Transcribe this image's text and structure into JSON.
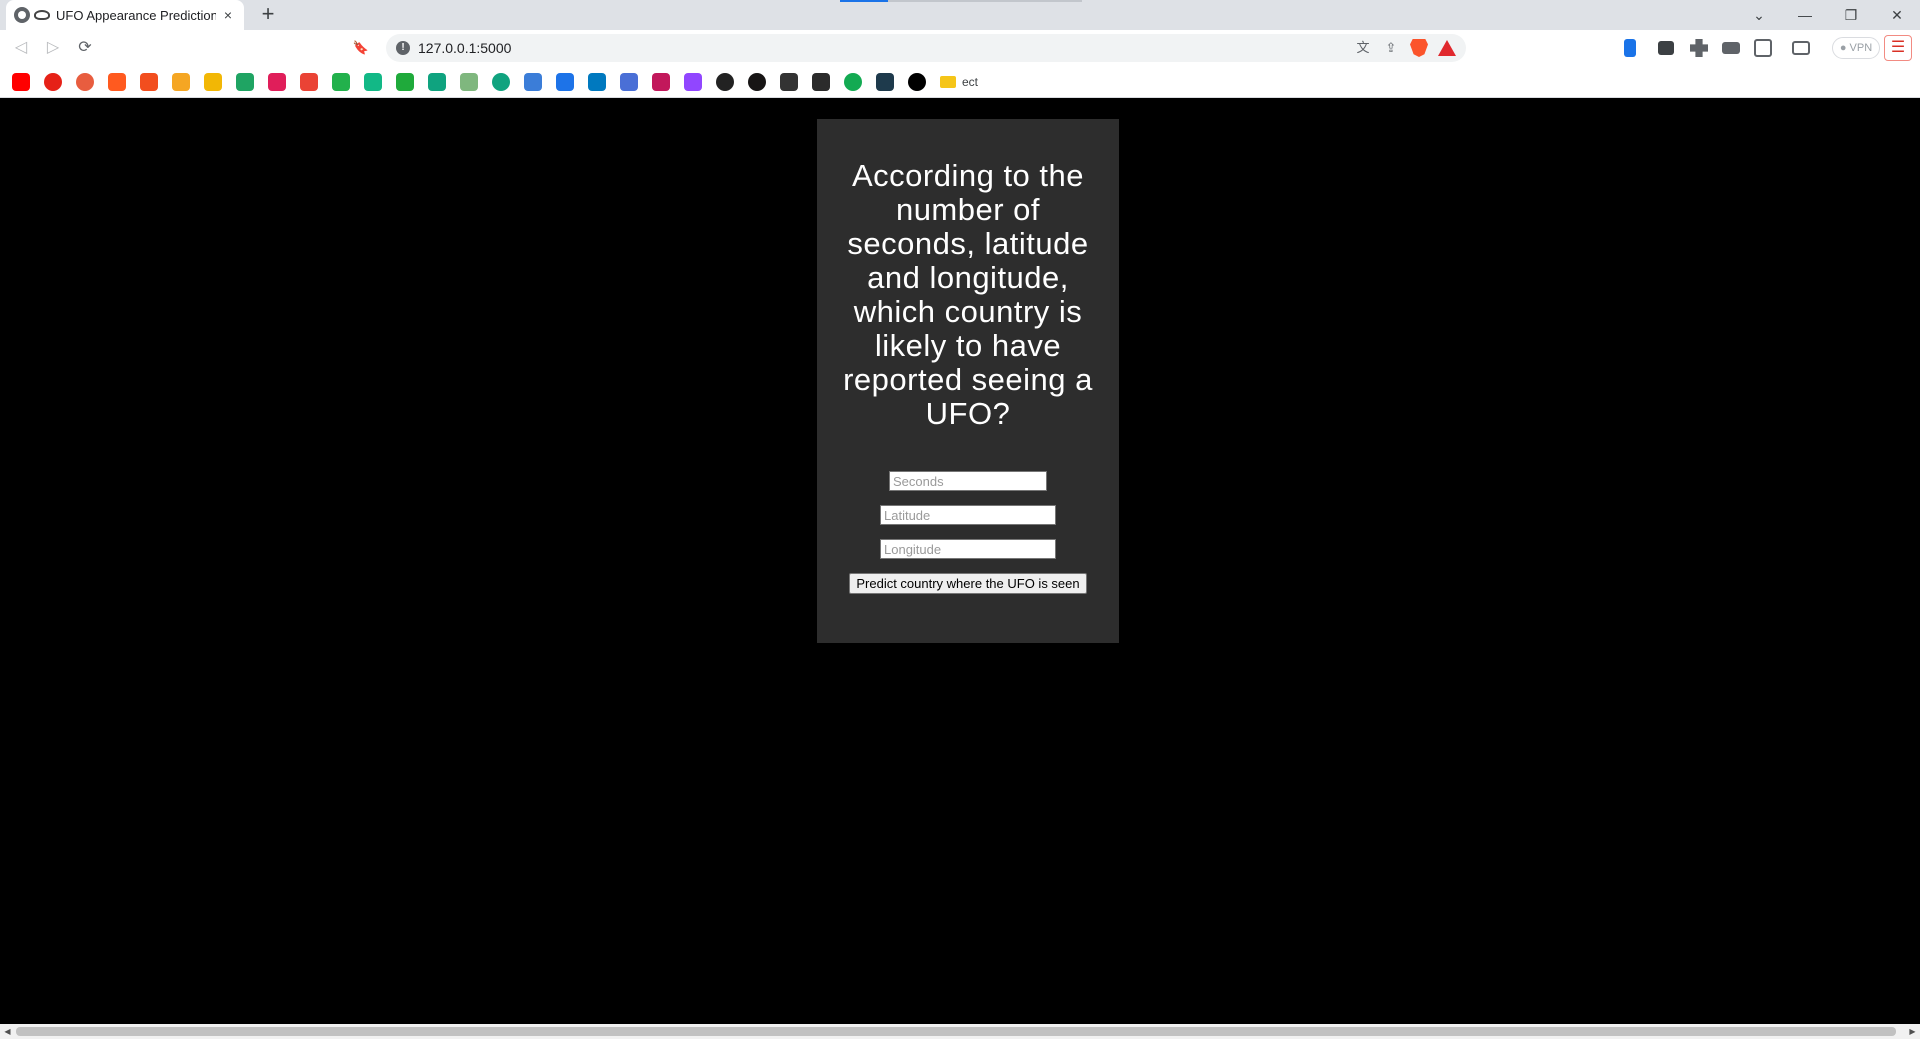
{
  "browser": {
    "tab": {
      "title": "UFO Appearance Prediction! (",
      "close": "×"
    },
    "new_tab": "+",
    "window_controls": {
      "tabsearch": "⌄",
      "minimize": "—",
      "restore": "❐",
      "close": "✕"
    },
    "nav": {
      "back": "◁",
      "forward": "▷",
      "reload": "⟳",
      "bookmark": "🔖"
    },
    "url": "127.0.0.1:5000",
    "omnibox_icons": [
      "translate-icon",
      "share-icon",
      "brave-shields-icon",
      "brave-rewards-icon"
    ],
    "vpn_label": "● VPN",
    "menu": "☰",
    "bookmarks": {
      "icons": [
        {
          "name": "youtube",
          "color": "#ff0000"
        },
        {
          "name": "youtube-music",
          "color": "#e62117"
        },
        {
          "name": "pinterest-like",
          "color": "#e85d3f"
        },
        {
          "name": "apple-like",
          "color": "#ff5a1f"
        },
        {
          "name": "figma-like",
          "color": "#f24e1e"
        },
        {
          "name": "warning-like",
          "color": "#f5a623"
        },
        {
          "name": "hand-like",
          "color": "#f2b705"
        },
        {
          "name": "drive",
          "color": "#1fa463"
        },
        {
          "name": "slack",
          "color": "#e01e5a"
        },
        {
          "name": "gmail",
          "color": "#ea4335"
        },
        {
          "name": "ac",
          "color": "#22b14c"
        },
        {
          "name": "green-chart",
          "color": "#12b886"
        },
        {
          "name": "green-doc",
          "color": "#1faa3b"
        },
        {
          "name": "edge-like",
          "color": "#0fa37f"
        },
        {
          "name": "map-like",
          "color": "#7fb77e"
        },
        {
          "name": "openai",
          "color": "#10a37f"
        },
        {
          "name": "code",
          "color": "#3b7dd8"
        },
        {
          "name": "kakao-k",
          "color": "#1d73e8"
        },
        {
          "name": "trello",
          "color": "#0079bf"
        },
        {
          "name": "blue-box",
          "color": "#4a6fd6"
        },
        {
          "name": "k-logo",
          "color": "#c2185b"
        },
        {
          "name": "twitch",
          "color": "#9146ff"
        },
        {
          "name": "globe",
          "color": "#222222"
        },
        {
          "name": "github",
          "color": "#171515"
        },
        {
          "name": "grad-cap",
          "color": "#333333"
        },
        {
          "name": "dark-box",
          "color": "#2b2b2b"
        },
        {
          "name": "mongodb",
          "color": "#13aa52"
        },
        {
          "name": "play-box",
          "color": "#1e3a4c"
        },
        {
          "name": "black-circle",
          "color": "#000000"
        }
      ],
      "folder_label": "ect"
    }
  },
  "page": {
    "question": "According to the number of seconds, latitude and longitude, which country is likely to have reported seeing a UFO?",
    "fields": {
      "seconds_placeholder": "Seconds",
      "latitude_placeholder": "Latitude",
      "longitude_placeholder": "Longitude"
    },
    "submit_label": "Predict country where the UFO is seen"
  },
  "colors": {
    "page_bg": "#000000",
    "card_bg": "#2d2d2d",
    "heading_text": "#ffffff"
  }
}
